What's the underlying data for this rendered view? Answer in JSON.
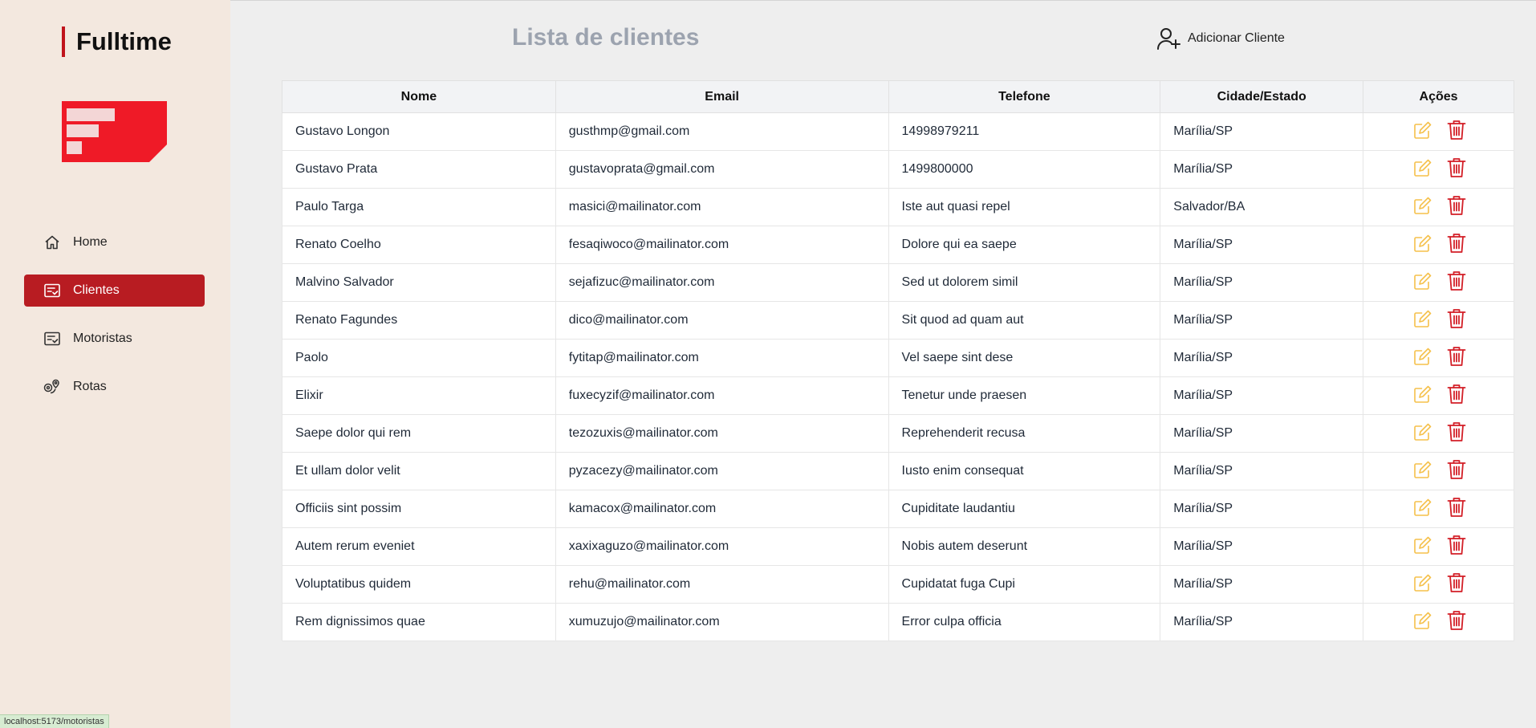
{
  "brand": {
    "name": "Fulltime"
  },
  "colors": {
    "accent": "#b81c22",
    "logo_red": "#ef1a27",
    "edit_icon": "#f5c04a",
    "delete_icon": "#d31f27"
  },
  "sidebar": {
    "items": [
      {
        "label": "Home",
        "icon": "home-icon",
        "active": false
      },
      {
        "label": "Clientes",
        "icon": "list-check-icon",
        "active": true
      },
      {
        "label": "Motoristas",
        "icon": "list-check-icon",
        "active": false
      },
      {
        "label": "Rotas",
        "icon": "route-pin-icon",
        "active": false
      }
    ]
  },
  "main": {
    "title": "Lista de clientes",
    "add_button_label": "Adicionar Cliente"
  },
  "table": {
    "columns": [
      "Nome",
      "Email",
      "Telefone",
      "Cidade/Estado",
      "Ações"
    ],
    "rows": [
      [
        "Gustavo Longon",
        "gusthmp@gmail.com",
        "14998979211",
        "Marília/SP"
      ],
      [
        "Gustavo Prata",
        "gustavoprata@gmail.com",
        "1499800000",
        "Marília/SP"
      ],
      [
        "Paulo Targa",
        "masici@mailinator.com",
        "Iste aut quasi repel",
        "Salvador/BA"
      ],
      [
        "Renato Coelho",
        "fesaqiwoco@mailinator.com",
        "Dolore qui ea saepe",
        "Marília/SP"
      ],
      [
        "Malvino Salvador",
        "sejafizuc@mailinator.com",
        "Sed ut dolorem simil",
        "Marília/SP"
      ],
      [
        "Renato Fagundes",
        "dico@mailinator.com",
        "Sit quod ad quam aut",
        "Marília/SP"
      ],
      [
        "Paolo",
        "fytitap@mailinator.com",
        "Vel saepe sint dese",
        "Marília/SP"
      ],
      [
        "Elixir",
        "fuxecyzif@mailinator.com",
        "Tenetur unde praesen",
        "Marília/SP"
      ],
      [
        "Saepe dolor qui rem",
        "tezozuxis@mailinator.com",
        "Reprehenderit recusa",
        "Marília/SP"
      ],
      [
        "Et ullam dolor velit",
        "pyzacezy@mailinator.com",
        "Iusto enim consequat",
        "Marília/SP"
      ],
      [
        "Officiis sint possim",
        "kamacox@mailinator.com",
        "Cupiditate laudantiu",
        "Marília/SP"
      ],
      [
        "Autem rerum eveniet",
        "xaxixaguzo@mailinator.com",
        "Nobis autem deserunt",
        "Marília/SP"
      ],
      [
        "Voluptatibus quidem",
        "rehu@mailinator.com",
        "Cupidatat fuga Cupi",
        "Marília/SP"
      ],
      [
        "Rem dignissimos quae",
        "xumuzujo@mailinator.com",
        "Error culpa officia",
        "Marília/SP"
      ]
    ]
  },
  "status_bar": {
    "url": "localhost:5173/motoristas"
  }
}
